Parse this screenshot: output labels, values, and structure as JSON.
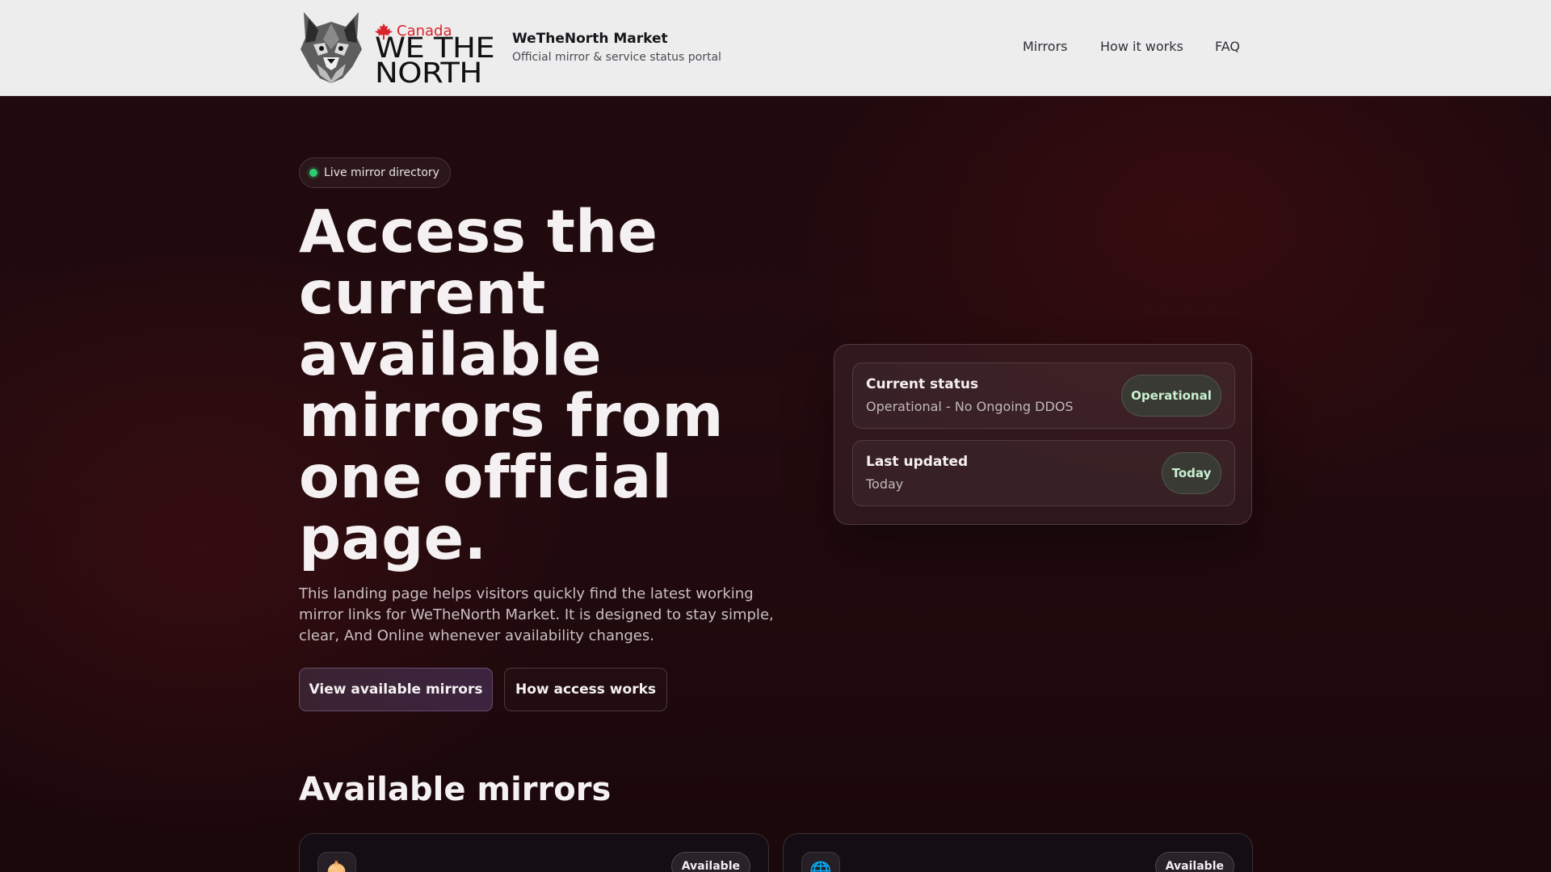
{
  "header": {
    "logo": {
      "country": "Canada",
      "wordmark": "WE THE\nNORTH"
    },
    "brand_title": "WeTheNorth Market",
    "brand_subtitle": "Official mirror & service status portal",
    "nav": [
      "Mirrors",
      "How it works",
      "FAQ"
    ]
  },
  "hero": {
    "pill": "Live mirror directory",
    "title": "Access the current available mirrors from one official page.",
    "description": "This landing page helps visitors quickly find the latest working mirror links for WeTheNorth Market. It is designed to stay simple, clear, And Online whenever availability changes.",
    "primary_button": "View available mirrors",
    "secondary_button": "How access works"
  },
  "status": {
    "current": {
      "title": "Current status",
      "subtitle": "Operational - No Ongoing DDOS",
      "badge": "Operational"
    },
    "updated": {
      "title": "Last updated",
      "subtitle": "Today",
      "badge": "Today"
    }
  },
  "mirrors": {
    "title": "Available mirrors",
    "cards": [
      {
        "icon": "onion-icon",
        "glyph": "🧅",
        "status": "Available"
      },
      {
        "icon": "globe-icon",
        "glyph": "🌐",
        "status": "Available"
      }
    ]
  },
  "colors": {
    "accent_green": "#2ecc71",
    "canada_red": "#d7252d",
    "background": "#1c0b0e"
  }
}
